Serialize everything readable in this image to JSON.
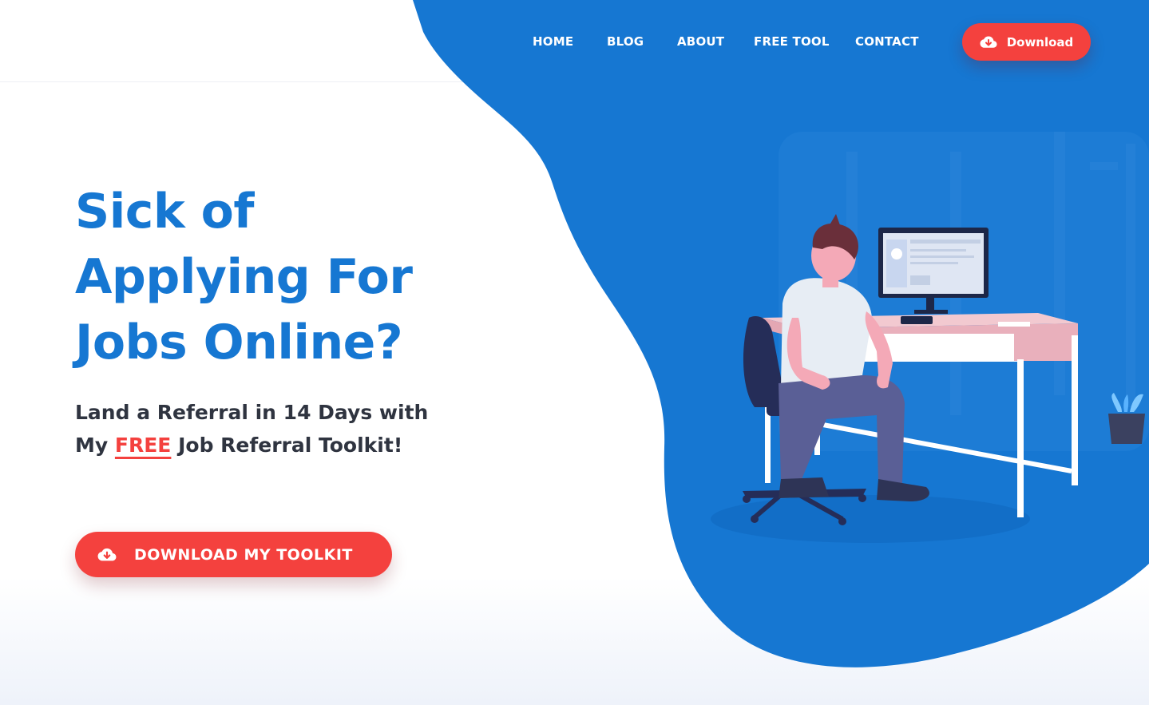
{
  "nav": {
    "items": [
      {
        "label": "HOME"
      },
      {
        "label": "BLOG"
      },
      {
        "label": "ABOUT"
      },
      {
        "label": "FREE TOOL"
      },
      {
        "label": "CONTACT"
      }
    ],
    "download_label": "Download"
  },
  "hero": {
    "headline_line1": "Sick of",
    "headline_line2": "Applying For",
    "headline_line3": "Jobs Online?",
    "sub_line1": "Land a Referral in 14 Days with",
    "sub_prefix": "My",
    "sub_free": "FREE",
    "sub_suffix": "Job Referral Toolkit!",
    "cta_label": "DOWNLOAD MY TOOLKIT"
  },
  "colors": {
    "brand_blue": "#1677d2",
    "accent_red": "#f4413e"
  },
  "icons": {
    "download": "cloud-download-icon"
  }
}
